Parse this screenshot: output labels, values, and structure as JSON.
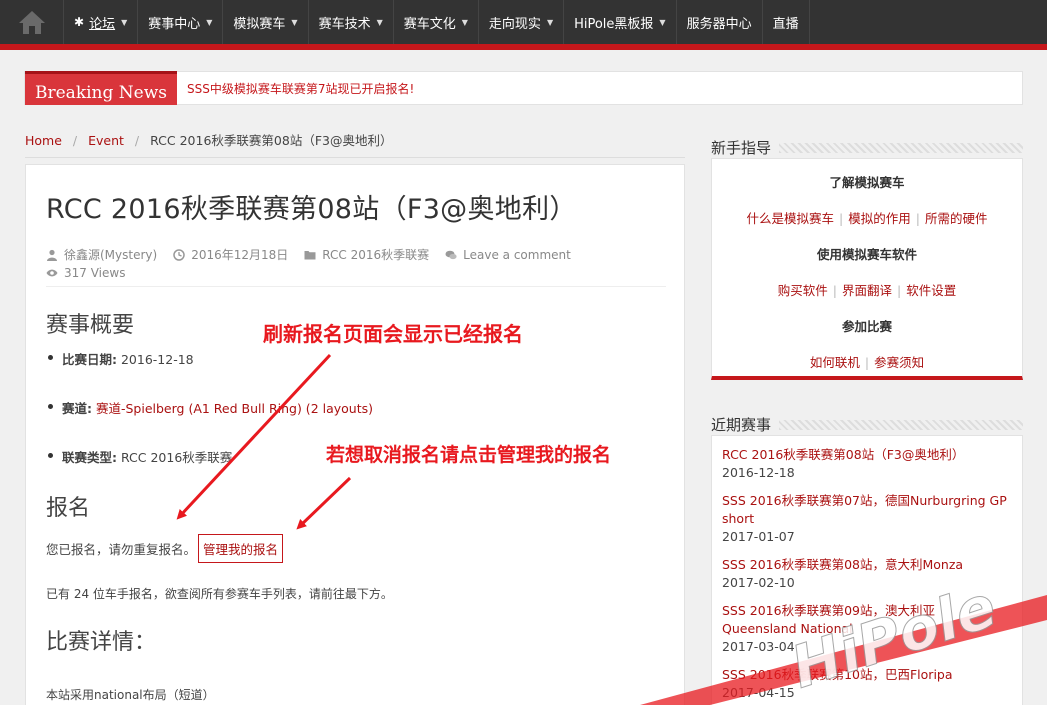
{
  "nav": {
    "items": [
      {
        "label": "论坛",
        "caret": true,
        "active": true
      },
      {
        "label": "赛事中心",
        "caret": true
      },
      {
        "label": "模拟赛车",
        "caret": true
      },
      {
        "label": "赛车技术",
        "caret": true
      },
      {
        "label": "赛车文化",
        "caret": true
      },
      {
        "label": "走向现实",
        "caret": true
      },
      {
        "label": "HiPole黑板报",
        "caret": true
      },
      {
        "label": "服务器中心",
        "caret": false
      },
      {
        "label": "直播",
        "caret": false
      }
    ]
  },
  "breaking": {
    "tag": "Breaking News",
    "text": "SSS中级模拟赛车联赛第7站现已开启报名!"
  },
  "breadcrumb": {
    "home": "Home",
    "event": "Event",
    "current": "RCC 2016秋季联赛第08站（F3@奥地利）"
  },
  "post": {
    "title": "RCC 2016秋季联赛第08站（F3@奥地利）",
    "author": "徐鑫源(Mystery)",
    "date": "2016年12月18日",
    "category": "RCC 2016秋季联赛",
    "comment": "Leave a comment",
    "views": "317 Views",
    "overview_heading": "赛事概要",
    "details": {
      "date_label": "比赛日期:",
      "date_value": "2016-12-18",
      "track_label": "赛道:",
      "track_value": "赛道-Spielberg (A1 Red Bull Ring) (2 layouts)",
      "type_label": "联赛类型:",
      "type_value": "RCC 2016秋季联赛"
    },
    "signup_heading": "报名",
    "signup_text": "您已报名，请勿重复报名。",
    "manage_label": "管理我的报名",
    "count_text": "已有 24 位车手报名，欲查阅所有参赛车手列表，请前往最下方。",
    "details_heading": "比赛详情：",
    "layout_text": "本站采用national布局（短道）"
  },
  "annotations": {
    "refresh": "刷新报名页面会显示已经报名",
    "cancel": "若想取消报名请点击管理我的报名"
  },
  "sidebar": {
    "guide_title": "新手指导",
    "guide": {
      "sec1": "了解模拟赛车",
      "sec1_links": [
        "什么是模拟赛车",
        "模拟的作用",
        "所需的硬件"
      ],
      "sec2": "使用模拟赛车软件",
      "sec2_links": [
        "购买软件",
        "界面翻译",
        "软件设置"
      ],
      "sec3": "参加比赛",
      "sec3_links": [
        "如何联机",
        "参赛须知"
      ]
    },
    "recent_title": "近期赛事",
    "recent": [
      {
        "title": "RCC 2016秋季联赛第08站（F3@奥地利）",
        "date": "2016-12-18"
      },
      {
        "title": "SSS 2016秋季联赛第07站，德国Nurburgring GP short",
        "date": "2017-01-07"
      },
      {
        "title": "SSS 2016秋季联赛第08站，意大利Monza",
        "date": "2017-02-10"
      },
      {
        "title": "SSS 2016秋季联赛第09站，澳大利亚 Queensland National",
        "date": "2017-03-04"
      },
      {
        "title": "SSS 2016秋季联赛第10站，巴西Floripa",
        "date": "2017-04-15"
      }
    ]
  },
  "watermark": {
    "text": "HiPole"
  },
  "colors": {
    "brand_red": "#c5171b",
    "nav_bg": "#333333",
    "link": "#aa1111"
  }
}
